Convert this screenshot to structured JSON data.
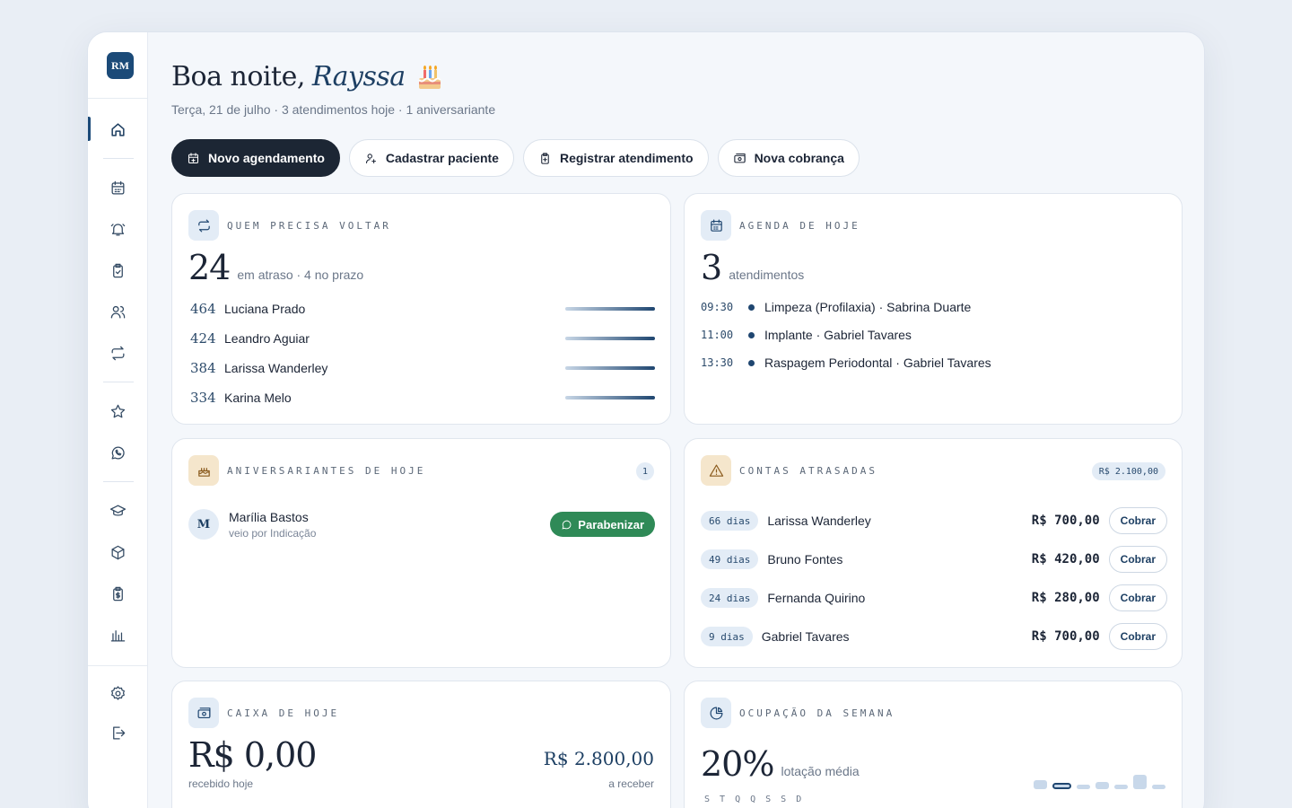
{
  "sidebar": {
    "logo": "RM",
    "items": [
      "home",
      "agenda",
      "alertas",
      "atendimentos",
      "pacientes",
      "retornos",
      "favoritos",
      "whatsapp",
      "cursos",
      "estoque",
      "financeiro",
      "relatorios",
      "configuracoes",
      "sair"
    ]
  },
  "header": {
    "greeting": "Boa noite,",
    "name": "Rayssa",
    "subline": "Terça, 21 de julho · 3 atendimentos hoje · 1 aniversariante"
  },
  "actions": {
    "novo": "Novo agendamento",
    "cadastrar": "Cadastrar paciente",
    "registrar": "Registrar atendimento",
    "cobranca": "Nova cobrança"
  },
  "retorno": {
    "title": "QUEM PRECISA VOLTAR",
    "count": "24",
    "caption": "em atraso · 4 no prazo",
    "rows": [
      {
        "days": "464",
        "name": "Luciana Prado",
        "level": 1.0
      },
      {
        "days": "424",
        "name": "Leandro Aguiar",
        "level": 1.0
      },
      {
        "days": "384",
        "name": "Larissa Wanderley",
        "level": 1.0
      },
      {
        "days": "334",
        "name": "Karina Melo",
        "level": 1.0
      }
    ]
  },
  "agenda": {
    "title": "AGENDA DE HOJE",
    "count": "3",
    "caption": "atendimentos",
    "rows": [
      {
        "time": "09:30",
        "text": "Limpeza (Profilaxia) · Sabrina Duarte"
      },
      {
        "time": "11:00",
        "text": "Implante · Gabriel Tavares"
      },
      {
        "time": "13:30",
        "text": "Raspagem Periodontal · Gabriel Tavares"
      }
    ]
  },
  "aniversariantes": {
    "title": "ANIVERSARIANTES DE HOJE",
    "badge": "1",
    "person": {
      "initial": "M",
      "name": "Marília Bastos",
      "source": "veio por Indicação"
    },
    "action": "Parabenizar"
  },
  "contas": {
    "title": "CONTAS ATRASADAS",
    "total": "R$ 2.100,00",
    "action": "Cobrar",
    "rows": [
      {
        "days": "66 dias",
        "name": "Larissa Wanderley",
        "value": "R$ 700,00"
      },
      {
        "days": "49 dias",
        "name": "Bruno Fontes",
        "value": "R$ 420,00"
      },
      {
        "days": "24 dias",
        "name": "Fernanda Quirino",
        "value": "R$ 280,00"
      },
      {
        "days": "9 dias",
        "name": "Gabriel Tavares",
        "value": "R$ 700,00"
      }
    ]
  },
  "caixa": {
    "title": "CAIXA DE HOJE",
    "received": "R$ 0,00",
    "received_caption": "recebido hoje",
    "to_receive": "R$ 2.800,00",
    "to_receive_caption": "a receber"
  },
  "ocupacao": {
    "title": "OCUPAÇÃO DA SEMANA",
    "value": "20%",
    "caption": "lotação média",
    "days": [
      "S",
      "T",
      "Q",
      "Q",
      "S",
      "S",
      "D"
    ],
    "levels": [
      0.5,
      0.35,
      0.2,
      0.4,
      0.25,
      0.8,
      0.15
    ],
    "today_index": 1
  },
  "colors": {
    "brand": "#1b4a78",
    "primary_button": "#1c2634",
    "whatsapp_green": "#2f8a57",
    "pill_bg": "#e3ecf6"
  }
}
